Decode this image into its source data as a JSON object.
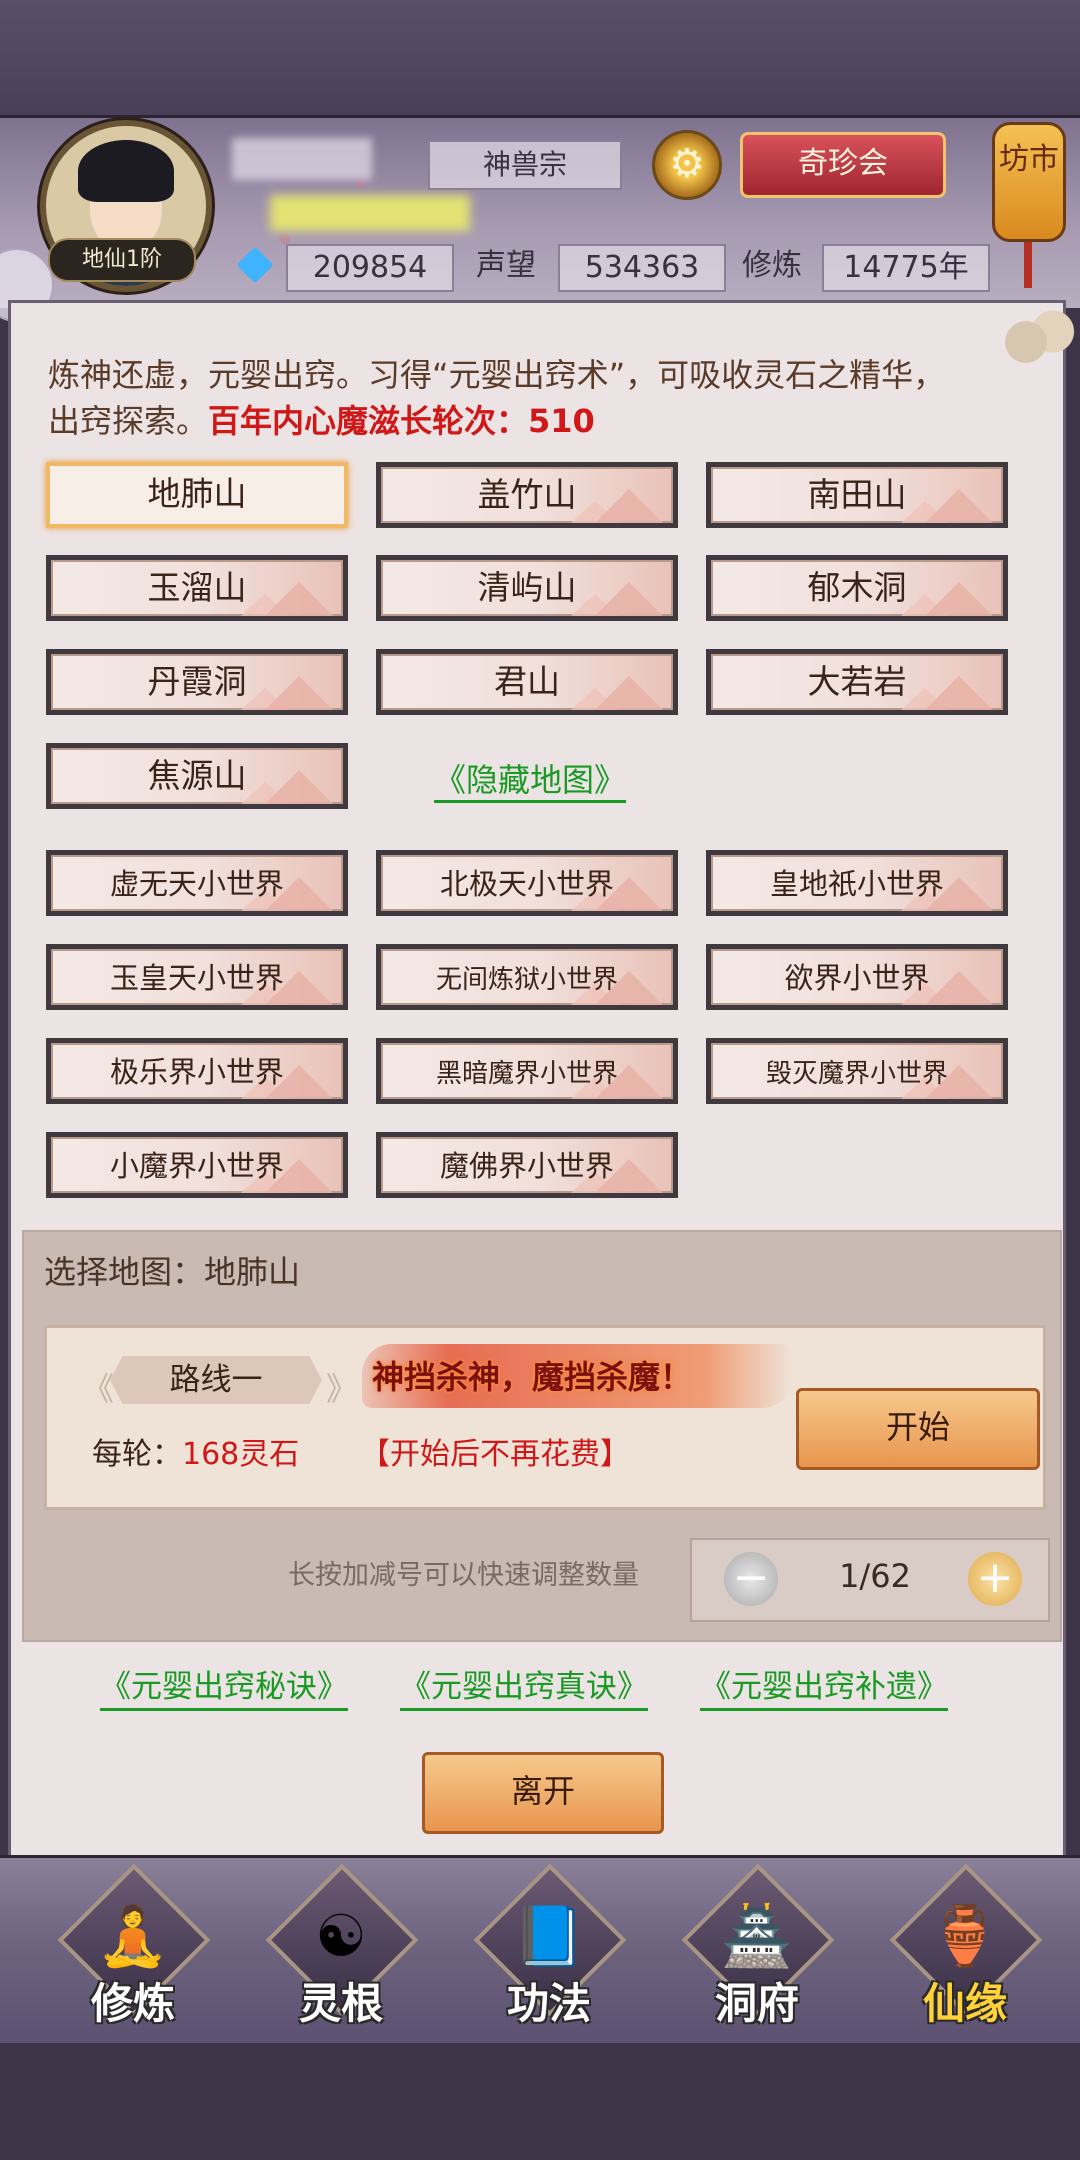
{
  "header": {
    "rank": "地仙1阶",
    "sect": "神兽宗",
    "shop_button": "奇珍会",
    "market_label": "坊市",
    "spirit_stones": "209854",
    "reputation_label": "声望",
    "reputation": "534363",
    "cultivation_label": "修炼",
    "cultivation_years": "14775年"
  },
  "intro": {
    "text": "炼神还虚，元婴出窍。习得“元婴出窍术”，可吸收灵石之精华，出窍探索。",
    "highlight": "百年内心魔滋长轮次：510"
  },
  "maps": [
    "地肺山",
    "盖竹山",
    "南田山",
    "玉溜山",
    "清屿山",
    "郁木洞",
    "丹霞洞",
    "君山",
    "大若岩",
    "焦源山"
  ],
  "hidden_map_link": "《隐藏地图》",
  "worlds": [
    "虚无天小世界",
    "北极天小世界",
    "皇地祇小世界",
    "玉皇天小世界",
    "无间炼狱小世界",
    "欲界小世界",
    "极乐界小世界",
    "黑暗魔界小世界",
    "毁灭魔界小世界",
    "小魔界小世界",
    "魔佛界小世界"
  ],
  "selection": {
    "label": "选择地图：地肺山",
    "route_tag": "路线一",
    "slogan": "神挡杀神，魔挡杀魔！",
    "per_round_label": "每轮：",
    "per_round_value": "168灵石",
    "no_cost": "【开始后不再花费】",
    "start_button": "开始",
    "hint": "长按加减号可以快速调整数量",
    "stepper_value": "1/62"
  },
  "guides": [
    "《元婴出窍秘诀》",
    "《元婴出窍真诀》",
    "《元婴出窍补遗》"
  ],
  "leave_button": "离开",
  "nav": [
    "修炼",
    "灵根",
    "功法",
    "洞府",
    "仙缘"
  ],
  "icons": [
    "gear-icon",
    "gem-icon",
    "minus-icon",
    "plus-icon",
    "cultivate-icon",
    "spirit-root-icon",
    "technique-book-icon",
    "cave-mansion-icon",
    "gourd-icon"
  ],
  "colors": {
    "accent_red": "#d01818",
    "link_green": "#1a9a24",
    "button_orange": "#e8954e"
  }
}
